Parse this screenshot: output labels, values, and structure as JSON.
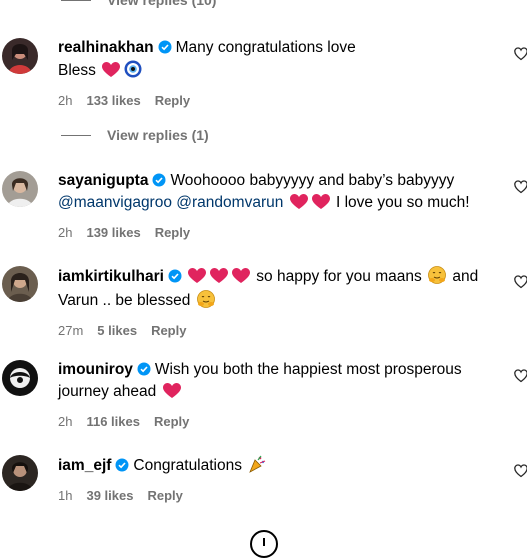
{
  "view_replies_top": "View replies (10)",
  "comments": [
    {
      "username": "realhinakhan",
      "line1": "Many congratulations love",
      "line2": "Bless",
      "time": "2h",
      "likes": "133 likes",
      "reply": "Reply",
      "view_replies": "View replies (1)"
    },
    {
      "username": "sayanigupta",
      "line1": "Woohoooo babyyyyy and baby’s babyyyy",
      "mention1": "@maanvigagroo",
      "mention2": "@randomvarun",
      "line2_tail": "I love you so much!",
      "time": "2h",
      "likes": "139 likes",
      "reply": "Reply"
    },
    {
      "username": "iamkirtikulhari",
      "line1_a": "so happy for you maans",
      "line1_b": "and",
      "line2": "Varun .. be blessed",
      "time": "27m",
      "likes": "5 likes",
      "reply": "Reply"
    },
    {
      "username": "imouniroy",
      "line1": "Wish you both the happiest most prosperous",
      "line2": "journey ahead",
      "time": "2h",
      "likes": "116 likes",
      "reply": "Reply"
    },
    {
      "username": "iam_ejf",
      "line1": "Congratulations",
      "time": "1h",
      "likes": "39 likes",
      "reply": "Reply"
    }
  ],
  "colors": {
    "verified": "#0095f6",
    "heart": "#e0245e",
    "muted": "#737373",
    "mention": "#00376b"
  },
  "icons": [
    "verified-badge-icon",
    "heart-outline-icon",
    "red-heart-emoji",
    "nazar-emoji",
    "hugging-face-emoji",
    "party-popper-emoji",
    "load-more-icon"
  ]
}
